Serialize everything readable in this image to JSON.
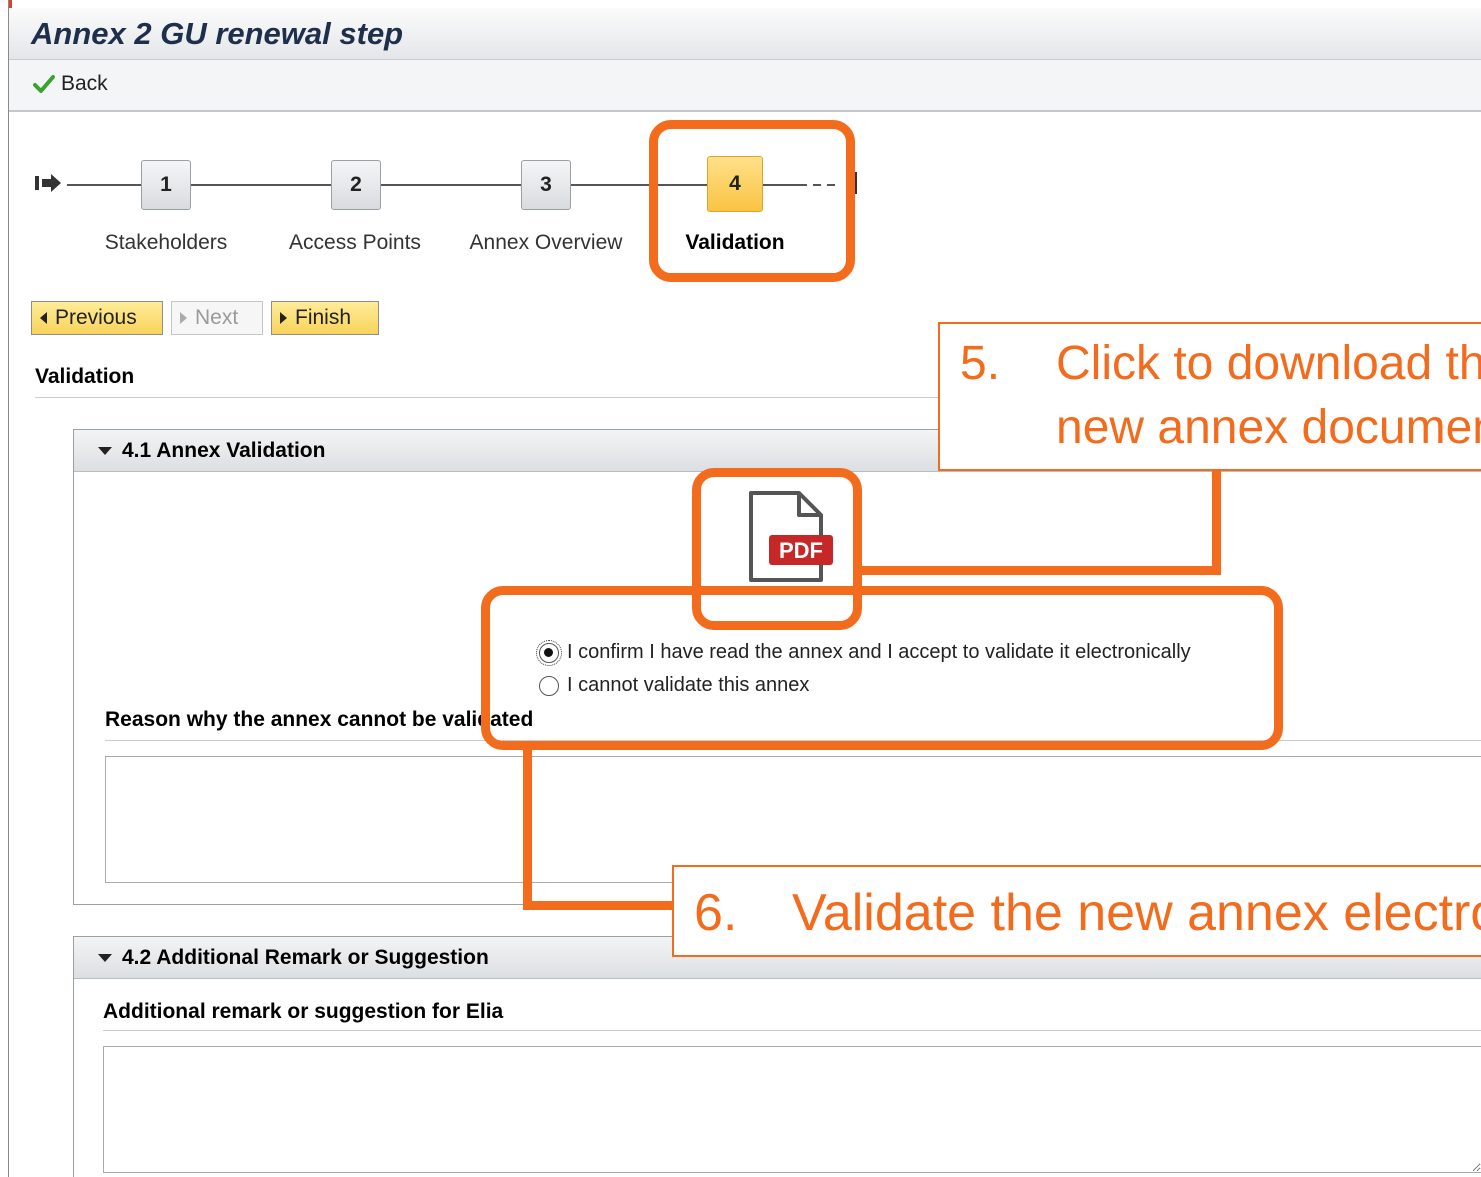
{
  "window": {
    "title": "Annex 2 GU renewal step",
    "back_label": "Back"
  },
  "roadmap": {
    "steps": [
      {
        "number": "1",
        "label": "Stakeholders"
      },
      {
        "number": "2",
        "label": "Access Points"
      },
      {
        "number": "3",
        "label": "Annex Overview"
      },
      {
        "number": "4",
        "label": "Validation"
      }
    ],
    "active_step": 4
  },
  "nav_buttons": {
    "previous": "Previous",
    "next": "Next",
    "finish": "Finish"
  },
  "section": {
    "title": "Validation"
  },
  "panel_validation": {
    "title": "4.1 Annex Validation",
    "pdf_icon_label": "PDF",
    "options": [
      {
        "label": "I confirm I have read the annex and I accept to validate it electronically",
        "selected": true
      },
      {
        "label": "I cannot validate this annex",
        "selected": false
      }
    ],
    "reason_label": "Reason why the annex cannot be validated",
    "reason_value": ""
  },
  "panel_remark": {
    "title": "4.2 Additional Remark or Suggestion",
    "remark_label": "Additional remark or suggestion for Elia",
    "remark_value": ""
  },
  "annotations": {
    "step5": {
      "number": "5.",
      "line1": "Click to download the",
      "line2": "new annex document"
    },
    "step6": {
      "number": "6.",
      "text": "Validate the new annex electronically"
    },
    "color": "#f36b1c"
  },
  "icons": {
    "back": "checkmark-icon",
    "roadmap_start": "roadmap-start-icon",
    "pdf": "pdf-file-icon"
  }
}
